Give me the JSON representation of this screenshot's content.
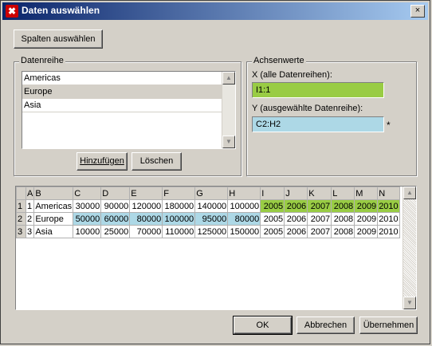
{
  "window": {
    "title": "Daten auswählen",
    "close_glyph": "×"
  },
  "select_columns_button": "Spalten auswählen",
  "datenreihe": {
    "legend": "Datenreihe",
    "items": [
      "Americas",
      "Europe",
      "Asia"
    ],
    "selected_index": 1,
    "add_button": "Hinzufügen",
    "delete_button": "Löschen"
  },
  "achsenwerte": {
    "legend": "Achsenwerte",
    "x_label": "X (alle Datenreihen):",
    "x_value": "I1:1",
    "y_label": "Y (ausgewählte Datenreihe):",
    "y_value": "C2:H2",
    "asterisk": "*",
    "x_color": "#99cc44",
    "y_color": "#add8e6"
  },
  "grid": {
    "columns": [
      "",
      "A",
      "B",
      "C",
      "D",
      "E",
      "F",
      "G",
      "H",
      "I",
      "J",
      "K",
      "L",
      "M",
      "N"
    ],
    "rows": [
      [
        "1",
        "1",
        "Americas",
        "30000",
        "90000",
        "120000",
        "180000",
        "140000",
        "100000",
        "2005",
        "2006",
        "2007",
        "2008",
        "2009",
        "2010"
      ],
      [
        "2",
        "2",
        "Europe",
        "50000",
        "60000",
        "80000",
        "100000",
        "95000",
        "80000",
        "2005",
        "2006",
        "2007",
        "2008",
        "2009",
        "2010"
      ],
      [
        "3",
        "3",
        "Asia",
        "10000",
        "25000",
        "70000",
        "110000",
        "125000",
        "150000",
        "2005",
        "2006",
        "2007",
        "2008",
        "2009",
        "2010"
      ]
    ]
  },
  "footer": {
    "ok": "OK",
    "cancel": "Abbrechen",
    "apply": "Übernehmen"
  }
}
